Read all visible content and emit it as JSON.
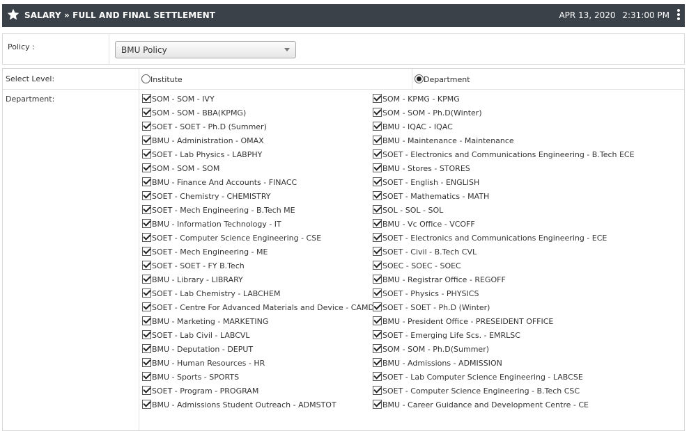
{
  "header": {
    "title": "SALARY » FULL AND FINAL SETTLEMENT",
    "date": "APR 13, 2020",
    "time": "2:31:00 PM",
    "icon": "star-icon",
    "menu_icon": "kebab-menu-icon"
  },
  "policy": {
    "label": "Policy :",
    "value": "BMU Policy"
  },
  "level": {
    "label": "Select Level:",
    "options": [
      "Institute",
      "Department"
    ],
    "selected": "Department"
  },
  "department": {
    "label": "Department:",
    "left": [
      "SOM - SOM - IVY",
      "SOM - SOM - BBA(KPMG)",
      "SOET - SOET - Ph.D (Summer)",
      "BMU - Administration - OMAX",
      "SOET - Lab Physics - LABPHY",
      "SOM - SOM - SOM",
      "BMU - Finance And Accounts - FINACC",
      "SOET - Chemistry - CHEMISTRY",
      "SOET - Mech Engineering - B.Tech ME",
      "BMU - Information Technology - IT",
      "SOET - Computer Science Engineering - CSE",
      "SOET - Mech Engineering - ME",
      "SOET - SOET - FY B.Tech",
      "BMU - Library - LIBRARY",
      "SOET - Lab Chemistry - LABCHEM",
      "SOET - Centre For Advanced Materials and Device - CAMD",
      "BMU - Marketing - MARKETING",
      "SOET - Lab Civil - LABCVL",
      "BMU - Deputation - DEPUT",
      "BMU - Human Resources - HR",
      "BMU - Sports - SPORTS",
      "SOET - Program - PROGRAM",
      "BMU - Admissions Student Outreach - ADMSTOT"
    ],
    "right": [
      "SOM - KPMG - KPMG",
      "SOM - SOM - Ph.D(Winter)",
      "BMU - IQAC - IQAC",
      "BMU - Maintenance - Maintenance",
      "SOET - Electronics and Communications Engineering - B.Tech ECE",
      "BMU - Stores - STORES",
      "SOET - English - ENGLISH",
      "SOET - Mathematics - MATH",
      "SOL - SOL - SOL",
      "BMU - Vc Office - VCOFF",
      "SOET - Electronics and Communications Engineering - ECE",
      "SOET - Civil - B.Tech CVL",
      "SOEC - SOEC - SOEC",
      "BMU - Registrar Office - REGOFF",
      "SOET - Physics - PHYSICS",
      "SOET - SOET - Ph.D (Winter)",
      "BMU - President Office - PRESEIDENT OFFICE",
      "SOET - Emerging Life Scs. - EMRLSC",
      "SOM - SOM - Ph.D(Summer)",
      "BMU - Admissions - ADMISSION",
      "SOET - Lab Computer Science Engineering - LABCSE",
      "SOET - Computer Science Engineering - B.Tech CSC",
      "BMU - Career Guidance and Development Centre - CE"
    ]
  }
}
